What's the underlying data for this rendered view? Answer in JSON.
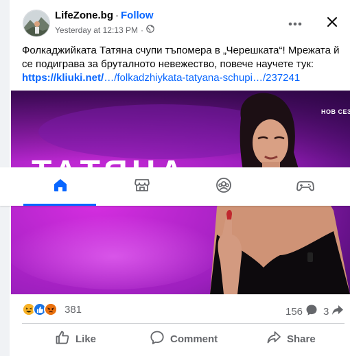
{
  "post": {
    "page_name": "LifeZone.bg",
    "dot": "·",
    "follow_label": "Follow",
    "timestamp": "Yesterday at 12:13 PM",
    "meta_dot": "·",
    "text": "Фолкаджийката Татяна счупи тъпомера в „Черешката“! Мрежата й се подиграва за бруталното невежество, повече научете тук: ",
    "link_domain": "https://kliuki.net/",
    "link_path": "…/folkadzhiykata-tatyana-schupi…/237241"
  },
  "media": {
    "badge": "НОВ СЕЗОН",
    "title": "ТАТЯНА"
  },
  "nav": {
    "items": [
      "home-icon",
      "marketplace-icon",
      "groups-icon",
      "gaming-icon"
    ],
    "active": "home"
  },
  "stats": {
    "reaction_icons": [
      "haha-icon",
      "like-icon",
      "angry-icon"
    ],
    "reactions": "381",
    "comments": "156",
    "shares": "3"
  },
  "actions": {
    "like": "Like",
    "comment": "Comment",
    "share": "Share"
  },
  "colors": {
    "accent": "#0866ff",
    "secondary_text": "#65676b",
    "media_bg": "#8e1fb3"
  }
}
